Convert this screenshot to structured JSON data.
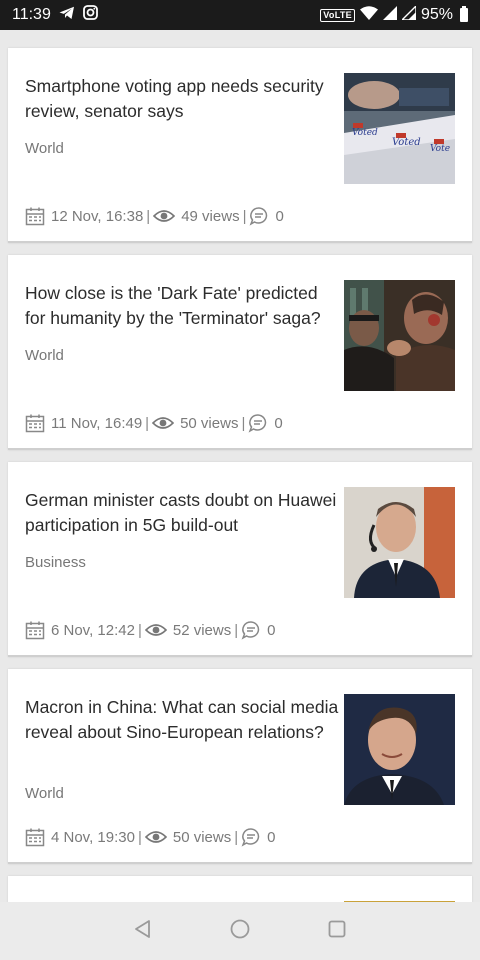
{
  "status_bar": {
    "time": "11:39",
    "network": "VoLTE",
    "battery": "95%",
    "icons": [
      "telegram-icon",
      "instagram-icon",
      "wifi-icon",
      "signal-icon",
      "battery-icon"
    ]
  },
  "articles": [
    {
      "title": "Smartphone voting app needs security review, senator says",
      "category": "World",
      "date": "12 Nov, 16:38",
      "views": "49 views",
      "comments": "0"
    },
    {
      "title": "How close is the 'Dark Fate' predicted for humanity by the 'Terminator' saga?",
      "category": "World",
      "date": "11 Nov, 16:49",
      "views": "50 views",
      "comments": "0"
    },
    {
      "title": "German minister casts doubt on Huawei participation in 5G build-out",
      "category": "Business",
      "date": "6 Nov, 12:42",
      "views": "52 views",
      "comments": "0"
    },
    {
      "title": "Macron in China: What can social media reveal about Sino-European relations?",
      "category": "World",
      "date": "4 Nov, 19:30",
      "views": "50 views",
      "comments": "0"
    }
  ],
  "thumb_text": {
    "voted": "Voted"
  },
  "nav_bar": {
    "icons": [
      "back-icon",
      "home-icon",
      "recents-icon"
    ]
  },
  "colors": {
    "status_bar": "#1b1b1b",
    "background": "#e9e9e9",
    "card": "#ffffff",
    "title": "#2c2c2c",
    "meta": "#7a7a7a"
  }
}
